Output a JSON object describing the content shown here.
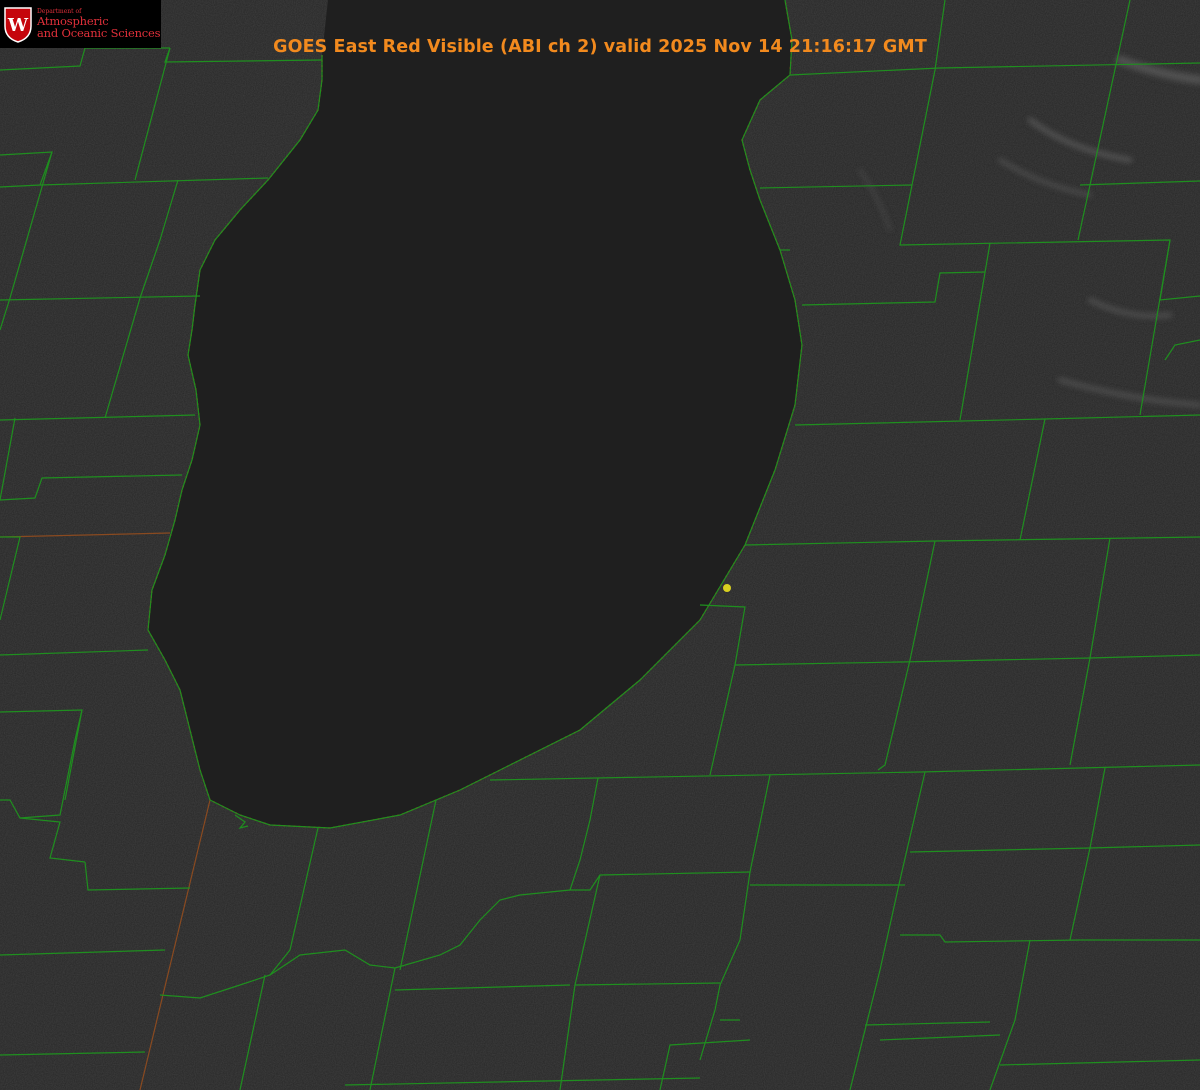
{
  "header": {
    "title": "GOES East Red Visible (ABI ch 2) valid 2025 Nov 14 21:16:17 GMT"
  },
  "logo": {
    "department": "Department of",
    "line1": "Atmospheric",
    "line2": "and Oceanic Sciences",
    "seal_letter": "W"
  },
  "colors": {
    "background": "#262626",
    "lake": "#1f1f1f",
    "county_lines": "#1f8f1f",
    "state_lines": "#d42020",
    "title": "#f28a1e",
    "logo": "#e0303a",
    "marker": "#d8d020"
  }
}
